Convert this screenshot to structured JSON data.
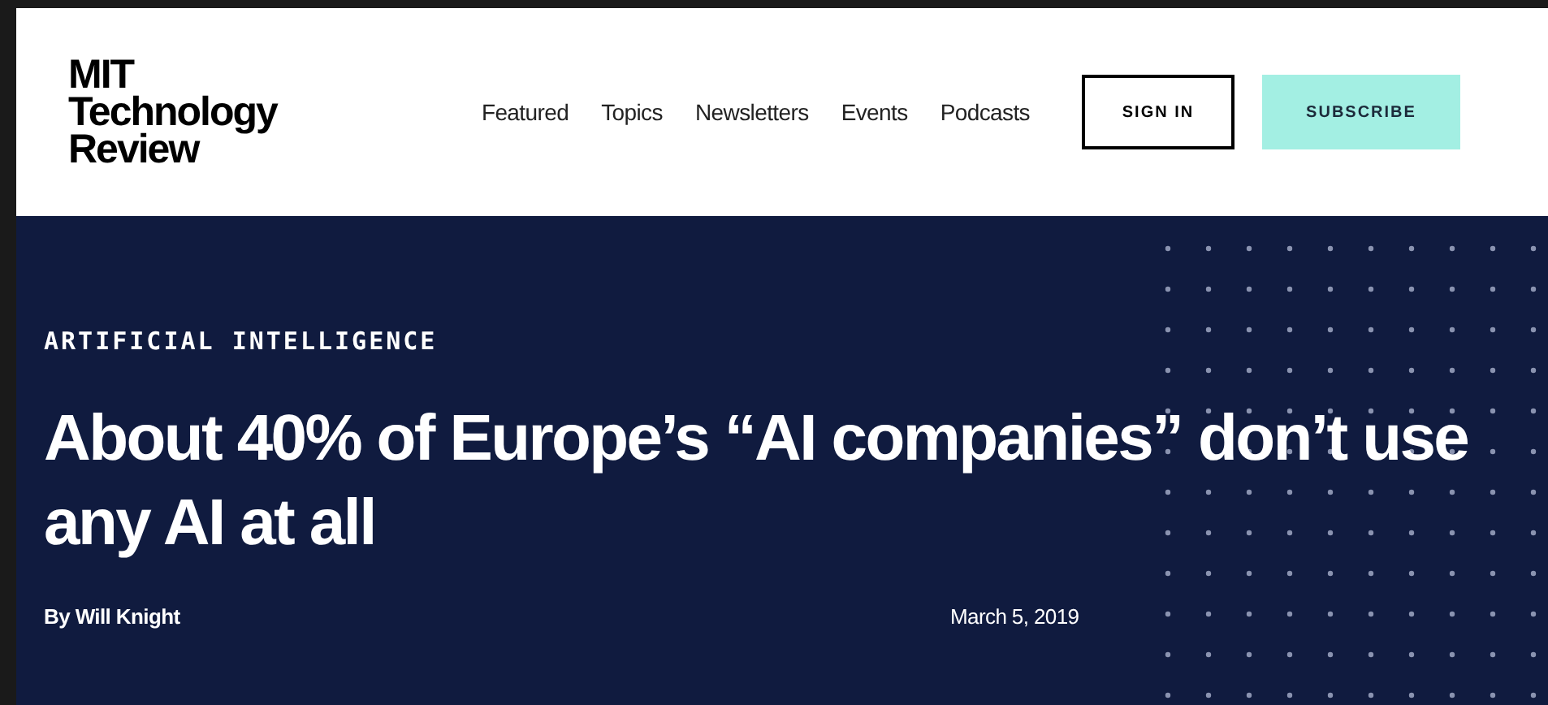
{
  "header": {
    "logo_lines": [
      "MIT",
      "Technology",
      "Review"
    ],
    "nav": [
      "Featured",
      "Topics",
      "Newsletters",
      "Events",
      "Podcasts"
    ],
    "buttons": [
      {
        "label": "SIGN IN",
        "kind": "outline"
      },
      {
        "label": "SUBSCRIBE",
        "kind": "filled"
      }
    ]
  },
  "article": {
    "category": "ARTIFICIAL INTELLIGENCE",
    "title": "About 40% of Europe’s “AI companies” don’t use any AI at all",
    "byline": "By Will Knight",
    "date": "March 5, 2019"
  }
}
